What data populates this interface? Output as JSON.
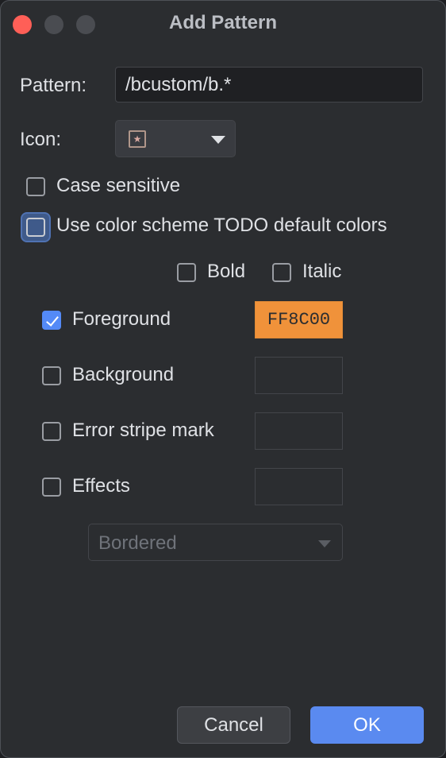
{
  "window": {
    "title": "Add Pattern"
  },
  "form": {
    "pattern_label": "Pattern:",
    "pattern_value": "/bcustom/b.*",
    "icon_label": "Icon:",
    "icon_selected": "bookmark-star-icon",
    "case_sensitive": {
      "label": "Case sensitive",
      "checked": false
    },
    "use_scheme_colors": {
      "label": "Use color scheme TODO default colors",
      "checked": false
    },
    "bold": {
      "label": "Bold",
      "checked": false
    },
    "italic": {
      "label": "Italic",
      "checked": false
    },
    "foreground": {
      "label": "Foreground",
      "checked": true,
      "color": "FF8C00"
    },
    "background": {
      "label": "Background",
      "checked": false
    },
    "error_stripe": {
      "label": "Error stripe mark",
      "checked": false
    },
    "effects": {
      "label": "Effects",
      "checked": false,
      "effect_type": "Bordered"
    }
  },
  "buttons": {
    "cancel": "Cancel",
    "ok": "OK"
  },
  "colors": {
    "accent": "#548af7",
    "foreground_swatch": "#ff8c00",
    "close_button": "#ff5f57",
    "background": "#2b2d30"
  }
}
